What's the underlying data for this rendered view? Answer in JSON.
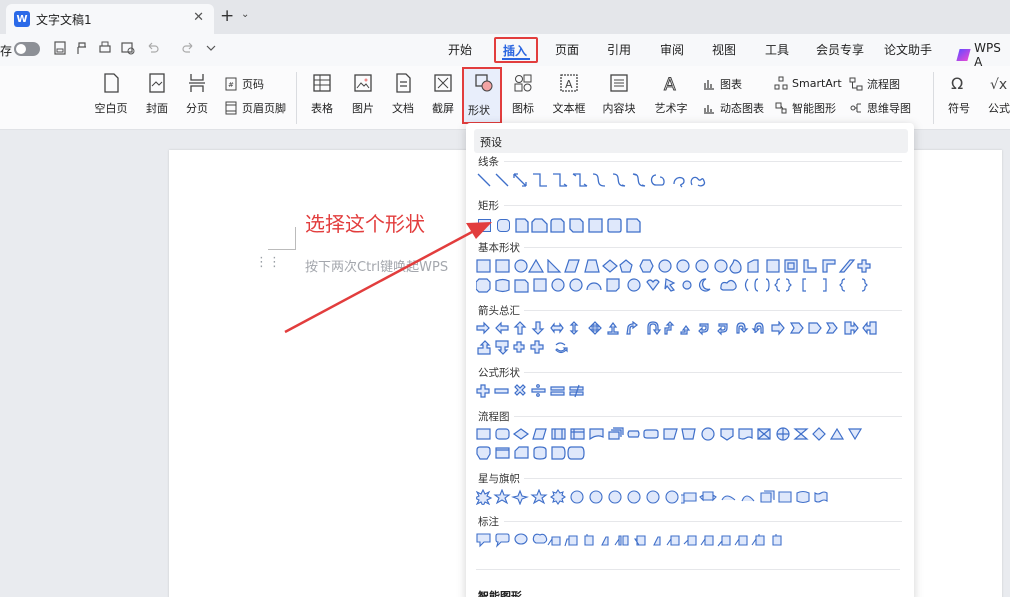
{
  "tab": {
    "logo": "W",
    "title": "文字文稿1",
    "close": "✕",
    "add": "+",
    "more": "⌄"
  },
  "quick_access": {
    "save_text": "存"
  },
  "menu": [
    "开始",
    "插入",
    "页面",
    "引用",
    "审阅",
    "视图",
    "工具",
    "会员专享",
    "论文助手"
  ],
  "wps_ai": "WPS A",
  "ribbon": {
    "blank_page": "空白页",
    "cover": "封面",
    "page_break": "分页",
    "page_number": "页码",
    "header_footer": "页眉页脚",
    "table": "表格",
    "picture": "图片",
    "document": "文档",
    "screenshot": "截屏",
    "shape": "形状",
    "icon": "图标",
    "textbox": "文本框",
    "content_block": "内容块",
    "wordart": "艺术字",
    "chart": "图表",
    "dynamic_chart": "动态图表",
    "smartart": "SmartArt",
    "smart_graphic": "智能图形",
    "flowchart": "流程图",
    "mindmap": "思维导图",
    "symbol": "符号",
    "formula": "公式"
  },
  "document": {
    "hint": "按下两次Ctrl键唤起WPS",
    "annotation": "选择这个形状"
  },
  "dropdown": {
    "header": "预设",
    "categories": {
      "lines": "线条",
      "rect": "矩形",
      "basic": "基本形状",
      "arrows": "箭头总汇",
      "formula": "公式形状",
      "flow": "流程图",
      "stars": "星与旗帜",
      "callouts": "标注"
    },
    "smart": "智能图形"
  },
  "colors": {
    "accent": "#2b66e0",
    "highlight": "#e23d3d",
    "shape_stroke": "#3f6fc9"
  }
}
